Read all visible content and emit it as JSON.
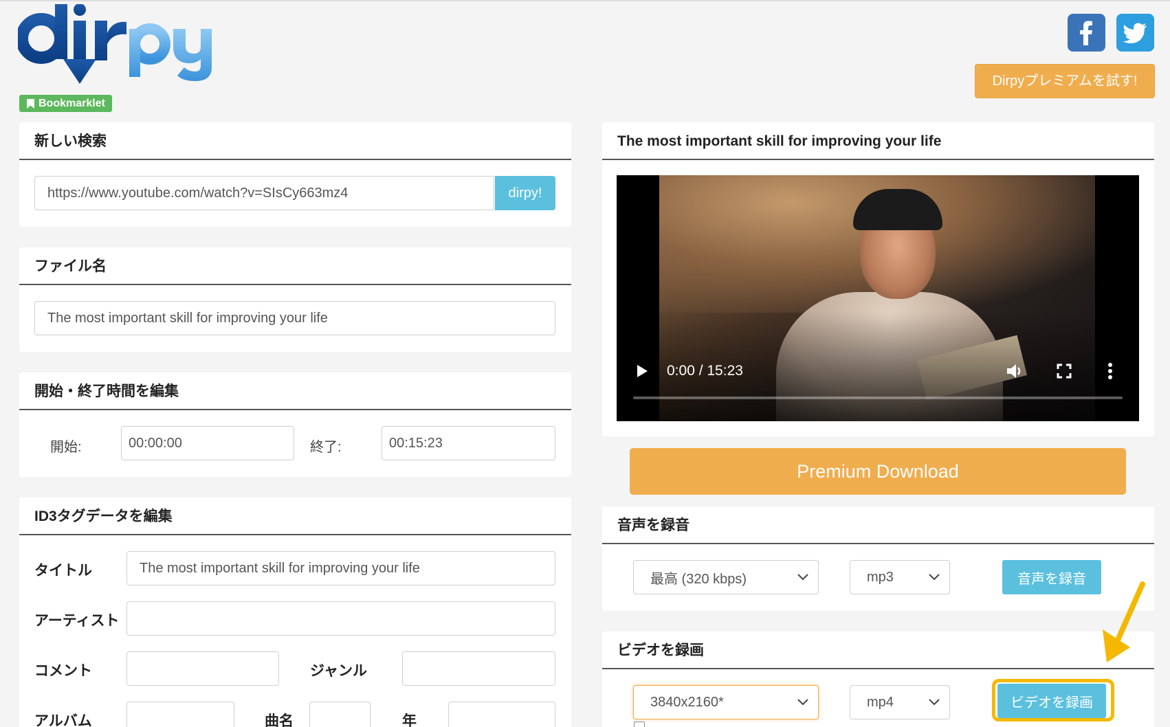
{
  "header": {
    "bookmarklet_label": "Bookmarklet",
    "premium_try_label": "Dirpyプレミアムを試す!"
  },
  "search": {
    "title": "新しい検索",
    "url_value": "https://www.youtube.com/watch?v=SIsCy663mz4",
    "submit_label": "dirpy!"
  },
  "filename": {
    "title": "ファイル名",
    "value": "The most important skill for improving your life"
  },
  "time_edit": {
    "title": "開始・終了時間を編集",
    "start_label": "開始:",
    "start_value": "00:00:00",
    "end_label": "終了:",
    "end_value": "00:15:23"
  },
  "id3": {
    "title": "ID3タグデータを編集",
    "title_label": "タイトル",
    "title_value": "The most important skill for improving your life",
    "artist_label": "アーティスト",
    "comment_label": "コメント",
    "genre_label": "ジャンル",
    "album_label": "アルバム",
    "track_label": "曲名",
    "year_label": "年"
  },
  "video": {
    "title": "The most important skill for improving your life",
    "time_display": "0:00 / 15:23"
  },
  "premium_download_label": "Premium Download",
  "audio": {
    "title": "音声を録音",
    "quality_selected": "最高 (320 kbps)",
    "format_selected": "mp3",
    "button_label": "音声を録音"
  },
  "video_record": {
    "title": "ビデオを録画",
    "resolution_selected": "3840x2160*",
    "format_selected": "mp4",
    "button_label": "ビデオを録画"
  },
  "colors": {
    "accent_orange": "#f0ad4e",
    "accent_blue": "#5bc0de",
    "bookmarklet_green": "#5cb85c",
    "highlight_yellow": "#f5b800"
  }
}
